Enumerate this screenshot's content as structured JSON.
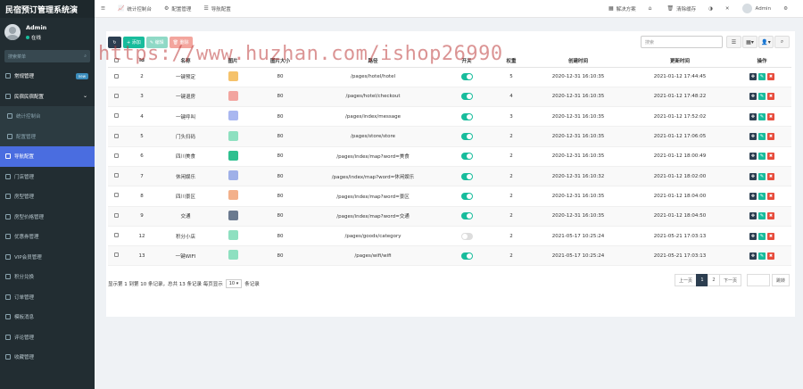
{
  "app": {
    "title": "民宿预订管理系统演"
  },
  "user": {
    "name": "Admin",
    "status": "在线"
  },
  "sidebar": {
    "search_placeholder": "搜索菜单",
    "items": [
      {
        "label": "常规管理",
        "badge": "new",
        "kind": "parent"
      },
      {
        "label": "民宿民宿配置",
        "kind": "parent",
        "open": true
      },
      {
        "label": "统计控制台",
        "kind": "sub"
      },
      {
        "label": "配置管理",
        "kind": "sub"
      },
      {
        "label": "导航配置",
        "kind": "active"
      },
      {
        "label": "门店管理",
        "kind": "normal"
      },
      {
        "label": "房型管理",
        "kind": "normal"
      },
      {
        "label": "房型价格管理",
        "kind": "normal"
      },
      {
        "label": "优惠券管理",
        "kind": "normal"
      },
      {
        "label": "VIP会员管理",
        "kind": "normal"
      },
      {
        "label": "积分兑换",
        "kind": "normal"
      },
      {
        "label": "订单管理",
        "kind": "normal"
      },
      {
        "label": "模板消息",
        "kind": "normal"
      },
      {
        "label": "评论管理",
        "kind": "normal"
      },
      {
        "label": "收藏管理",
        "kind": "normal"
      }
    ]
  },
  "topbar": {
    "left": [
      {
        "icon": "chart-icon",
        "label": "统计控制台"
      },
      {
        "icon": "gear-icon",
        "label": "配置管理"
      },
      {
        "icon": "list-icon",
        "label": "导航配置"
      }
    ],
    "right": [
      {
        "icon": "solution-icon",
        "label": "解决方案"
      },
      {
        "icon": "home-icon",
        "label": ""
      },
      {
        "icon": "trash-icon",
        "label": "清除缓存"
      }
    ],
    "user": "Admin"
  },
  "toolbar": {
    "add": "添加",
    "edit": "编辑",
    "delete": "删除"
  },
  "search": {
    "placeholder": "搜索"
  },
  "table": {
    "columns": [
      "Id",
      "名称",
      "图片",
      "图片大小",
      "路径",
      "开关",
      "权重",
      "创建时间",
      "更新时间",
      "操作"
    ],
    "rows": [
      {
        "id": "2",
        "name": "一键预定",
        "img_color": "#f5c26b",
        "size": "80",
        "path": "/pages/hotel/hotel",
        "on": true,
        "weigh": "5",
        "created": "2020-12-31 16:10:35",
        "updated": "2021-01-12 17:44:45"
      },
      {
        "id": "3",
        "name": "一键退房",
        "img_color": "#f2a5a0",
        "size": "80",
        "path": "/pages/hotel/checkout",
        "on": true,
        "weigh": "4",
        "created": "2020-12-31 16:10:35",
        "updated": "2021-01-12 17:48:22"
      },
      {
        "id": "4",
        "name": "一键呼叫",
        "img_color": "#a9b7f0",
        "size": "80",
        "path": "/pages/index/message",
        "on": true,
        "weigh": "3",
        "created": "2020-12-31 16:10:35",
        "updated": "2021-01-12 17:52:02"
      },
      {
        "id": "5",
        "name": "门头扫码",
        "img_color": "#8ee0c0",
        "size": "80",
        "path": "/pages/store/store",
        "on": true,
        "weigh": "2",
        "created": "2020-12-31 16:10:35",
        "updated": "2021-01-12 17:06:05"
      },
      {
        "id": "6",
        "name": "四川美食",
        "img_color": "#2ec08f",
        "size": "80",
        "path": "/pages/index/map?word=美食",
        "on": true,
        "weigh": "2",
        "created": "2020-12-31 16:10:35",
        "updated": "2021-01-12 18:00:49"
      },
      {
        "id": "7",
        "name": "休闲娱乐",
        "img_color": "#9fb0e8",
        "size": "80",
        "path": "/pages/index/map?word=休闲娱乐",
        "on": true,
        "weigh": "2",
        "created": "2020-12-31 16:10:32",
        "updated": "2021-01-12 18:02:00"
      },
      {
        "id": "8",
        "name": "四川景区",
        "img_color": "#f3b08a",
        "size": "80",
        "path": "/pages/index/map?word=景区",
        "on": true,
        "weigh": "2",
        "created": "2020-12-31 16:10:35",
        "updated": "2021-01-12 18:04:00"
      },
      {
        "id": "9",
        "name": "交通",
        "img_color": "#6b7a8f",
        "size": "80",
        "path": "/pages/index/map?word=交通",
        "on": true,
        "weigh": "2",
        "created": "2020-12-31 16:10:35",
        "updated": "2021-01-12 18:04:50"
      },
      {
        "id": "12",
        "name": "积分小店",
        "img_color": "#8ee0c0",
        "size": "80",
        "path": "/pages/goods/category",
        "on": false,
        "weigh": "2",
        "created": "2021-05-17 10:25:24",
        "updated": "2021-05-21 17:03:13"
      },
      {
        "id": "13",
        "name": "一键WIFI",
        "img_color": "#8ee0c0",
        "size": "80",
        "path": "/pages/wifi/wifi",
        "on": true,
        "weigh": "2",
        "created": "2021-05-17 10:25:24",
        "updated": "2021-05-21 17:03:13"
      }
    ]
  },
  "footer": {
    "prefix": "显示第 1 到第 10 条记录，总共 13 条记录 每页显示",
    "pagesize": "10",
    "suffix": "条记录"
  },
  "pager": {
    "prev": "上一页",
    "pages": [
      "1",
      "2"
    ],
    "next": "下一页",
    "go": "跳转"
  },
  "watermark": "https://www.huzhan.com/ishop26990"
}
